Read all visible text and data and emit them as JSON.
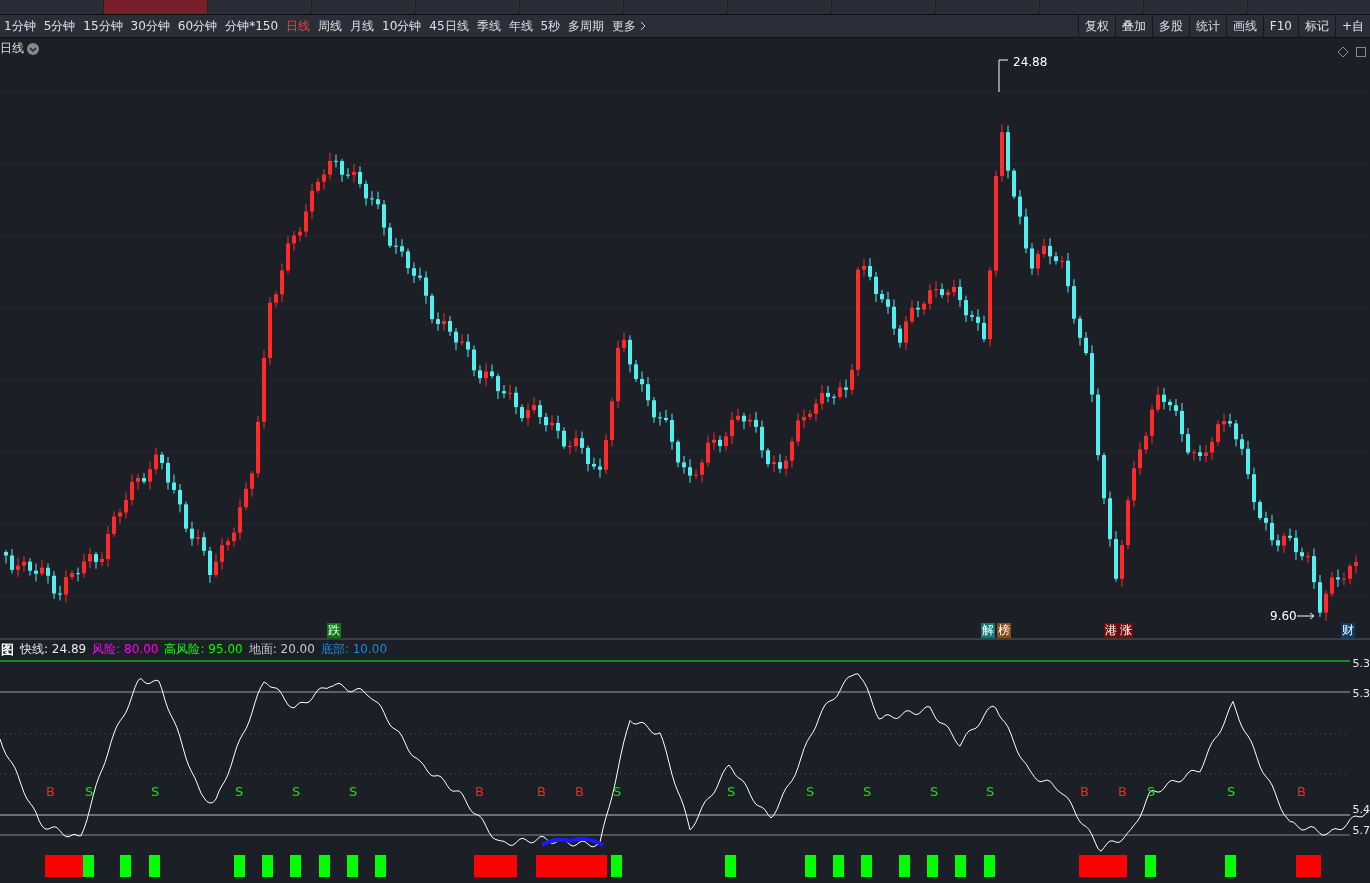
{
  "top_tabs": [
    {
      "selected": false
    },
    {
      "selected": true
    },
    {
      "selected": false
    },
    {
      "selected": false
    },
    {
      "selected": false
    },
    {
      "selected": false
    },
    {
      "selected": false
    },
    {
      "selected": false
    },
    {
      "selected": false
    },
    {
      "selected": false
    },
    {
      "selected": false
    },
    {
      "selected": false
    }
  ],
  "periods": [
    {
      "label": "1分钟",
      "selected": false
    },
    {
      "label": "5分钟",
      "selected": false
    },
    {
      "label": "15分钟",
      "selected": false
    },
    {
      "label": "30分钟",
      "selected": false
    },
    {
      "label": "60分钟",
      "selected": false
    },
    {
      "label": "分钟*150",
      "selected": false
    },
    {
      "label": "日线",
      "selected": true
    },
    {
      "label": "周线",
      "selected": false
    },
    {
      "label": "月线",
      "selected": false
    },
    {
      "label": "10分钟",
      "selected": false
    },
    {
      "label": "45日线",
      "selected": false
    },
    {
      "label": "季线",
      "selected": false
    },
    {
      "label": "年线",
      "selected": false
    },
    {
      "label": "5秒",
      "selected": false
    },
    {
      "label": "多周期",
      "selected": false
    },
    {
      "label": "更多",
      "selected": false
    }
  ],
  "tools": [
    "复权",
    "叠加",
    "多股",
    "统计",
    "画线",
    "F10",
    "标记",
    "+自"
  ],
  "main_chart": {
    "title": "日线",
    "high_label": "24.88",
    "low_label": "9.60",
    "events": [
      {
        "label": "跌",
        "color": "#0a7a14"
      },
      {
        "label": "解",
        "color": "#0f7a7a"
      },
      {
        "label": "榜",
        "color": "#8a4a10"
      },
      {
        "label": "港",
        "color": "#7a0a0a"
      },
      {
        "label": "涨",
        "color": "#7a0a0a"
      },
      {
        "label": "财",
        "color": "#0c3a6a"
      }
    ]
  },
  "indicator": {
    "legend": [
      {
        "text": "图",
        "color": "#ffffff"
      },
      {
        "text": "快线: 24.89",
        "color": "#e8e8e8"
      },
      {
        "text": "风险: 80.00",
        "color": "#ff00ff"
      },
      {
        "text": "高风险: 95.00",
        "color": "#00ff00"
      },
      {
        "text": "地面: 20.00",
        "color": "#c8c8c8"
      },
      {
        "text": "底部: 10.00",
        "color": "#1e8ad6"
      }
    ],
    "axis_labels": [
      "5.3",
      "5.3",
      "5.4",
      "5.7"
    ],
    "signals": [
      {
        "label": "B",
        "kind": "buy"
      },
      {
        "label": "S",
        "kind": "sell"
      },
      {
        "label": "S",
        "kind": "sell"
      },
      {
        "label": "S",
        "kind": "sell"
      },
      {
        "label": "S",
        "kind": "sell"
      },
      {
        "label": "S",
        "kind": "sell"
      },
      {
        "label": "B",
        "kind": "buy"
      },
      {
        "label": "B",
        "kind": "buy"
      },
      {
        "label": "B",
        "kind": "buy"
      },
      {
        "label": "S",
        "kind": "sell"
      },
      {
        "label": "S",
        "kind": "sell"
      },
      {
        "label": "S",
        "kind": "sell"
      },
      {
        "label": "S",
        "kind": "sell"
      },
      {
        "label": "S",
        "kind": "sell"
      },
      {
        "label": "S",
        "kind": "sell"
      },
      {
        "label": "B",
        "kind": "buy"
      },
      {
        "label": "B",
        "kind": "buy"
      },
      {
        "label": "S",
        "kind": "sell"
      },
      {
        "label": "S",
        "kind": "sell"
      },
      {
        "label": "B",
        "kind": "buy"
      }
    ],
    "blocks": [
      {
        "kind": "buy"
      },
      {
        "kind": "sell"
      },
      {
        "kind": "sell"
      },
      {
        "kind": "sell"
      },
      {
        "kind": "sell"
      },
      {
        "kind": "sell"
      },
      {
        "kind": "sell"
      },
      {
        "kind": "sell"
      },
      {
        "kind": "sell"
      },
      {
        "kind": "sell"
      },
      {
        "kind": "buy"
      },
      {
        "kind": "buy"
      },
      {
        "kind": "sell"
      },
      {
        "kind": "sell"
      },
      {
        "kind": "sell"
      },
      {
        "kind": "sell"
      },
      {
        "kind": "sell"
      },
      {
        "kind": "sell"
      },
      {
        "kind": "sell"
      },
      {
        "kind": "sell"
      },
      {
        "kind": "sell"
      },
      {
        "kind": "buy"
      },
      {
        "kind": "sell"
      },
      {
        "kind": "sell"
      },
      {
        "kind": "buy"
      }
    ]
  }
}
